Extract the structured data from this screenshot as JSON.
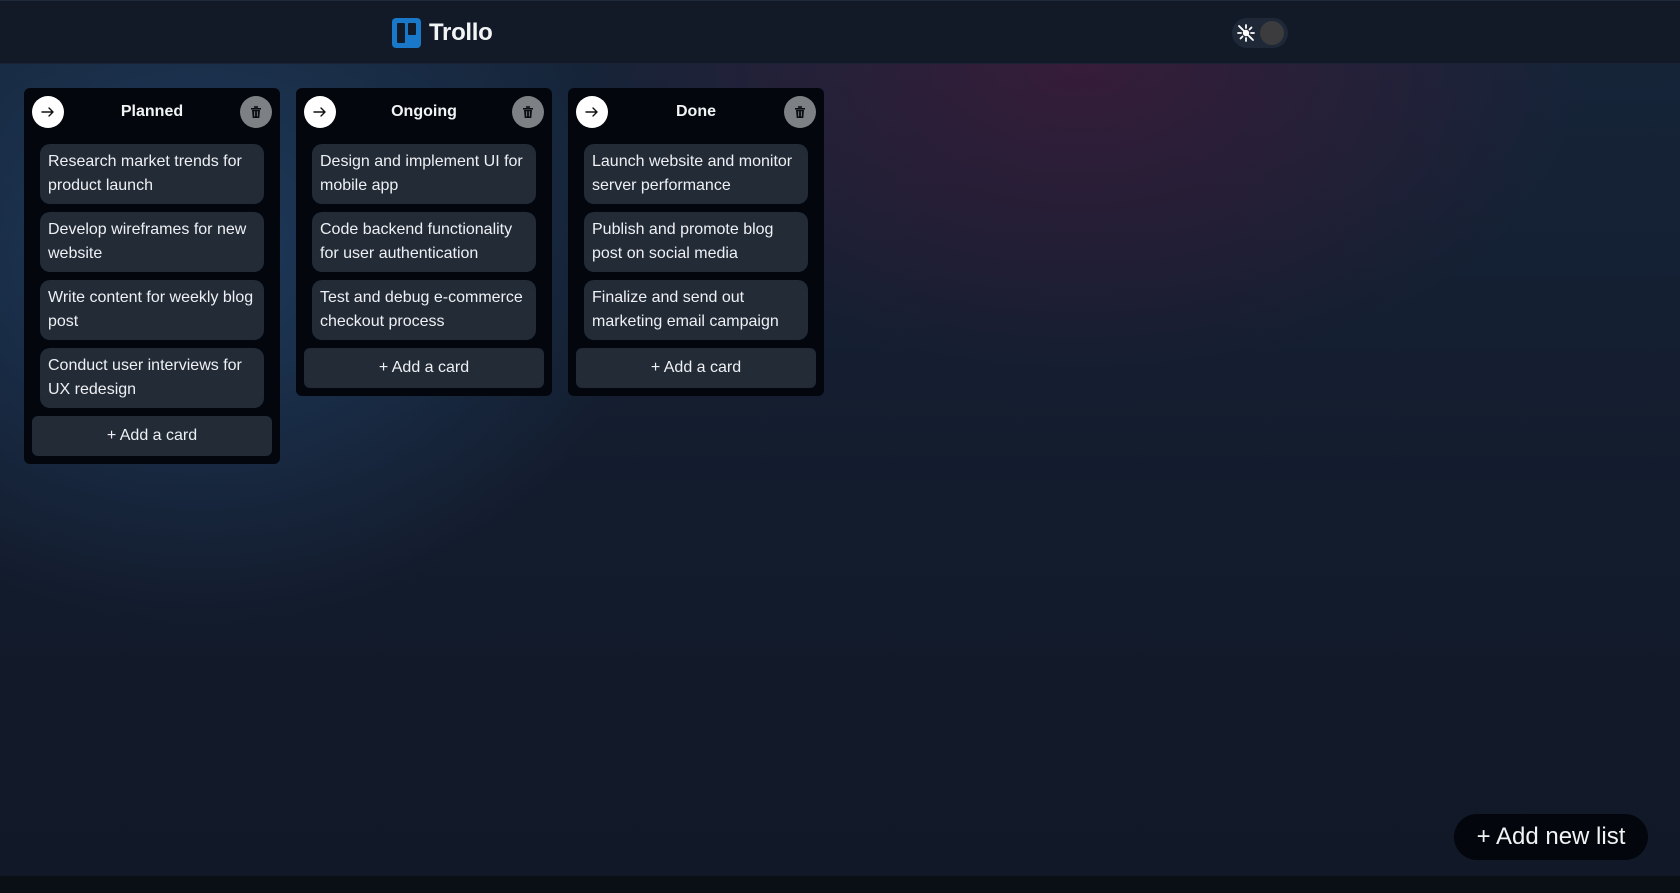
{
  "header": {
    "app_name": "Trollo",
    "logo_icon": "trello-board-icon",
    "theme_toggle_icon": "sun-off-icon",
    "accent": "#1978c8"
  },
  "lists": [
    {
      "title": "Planned",
      "cards": [
        "Research market trends for product launch",
        "Develop wireframes for new website",
        "Write content for weekly blog post",
        "Conduct user interviews for UX redesign"
      ],
      "add_card_label": "+ Add a card"
    },
    {
      "title": "Ongoing",
      "cards": [
        "Design and implement UI for mobile app",
        "Code backend functionality for user authentication",
        "Test and debug e-commerce checkout process"
      ],
      "add_card_label": "+ Add a card"
    },
    {
      "title": "Done",
      "cards": [
        "Launch website and monitor server performance",
        "Publish and promote blog post on social media",
        "Finalize and send out marketing email campaign"
      ],
      "add_card_label": "+ Add a card"
    }
  ],
  "add_list_label": "+ Add new list"
}
